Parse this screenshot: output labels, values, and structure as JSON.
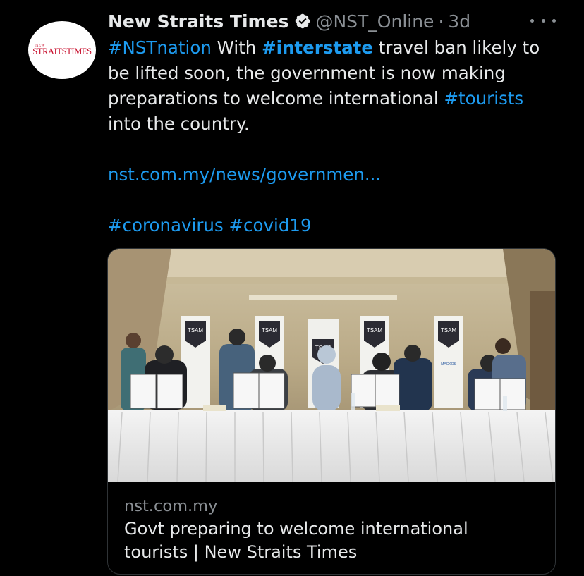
{
  "author": {
    "avatar_small": "NEW",
    "avatar_text": "STRAITSTIMES",
    "name": "New Straits Times",
    "handle": "@NST_Online",
    "separator": "·",
    "time": "3d"
  },
  "tweet": {
    "line1_tag": "#NSTnation",
    "line1_text": " With ",
    "line1_tag2": "#interstate",
    "line1_rest": " travel ban likely to",
    "line2": "be lifted soon, the government is now making",
    "line3_text": "preparations to welcome international ",
    "line3_tag": "#tourists",
    "line4": "into the country.",
    "link": "nst.com.my/news/governmen...",
    "tag_a": "#coronavirus",
    "tag_b": "#covid19"
  },
  "card": {
    "domain": "nst.com.my",
    "title_line1": "Govt preparing to welcome international",
    "title_line2": "tourists | New Straits Times",
    "banner_text": "TSAM",
    "banner_subtext": "MACKOS"
  },
  "colors": {
    "background": "#000000",
    "link": "#1d9bf0",
    "text": "#e7e9ea",
    "muted": "#8b9095",
    "border": "#2f3336",
    "brand_red": "#c8102e"
  },
  "icons": [
    "verified-badge-icon",
    "more-options-icon"
  ]
}
